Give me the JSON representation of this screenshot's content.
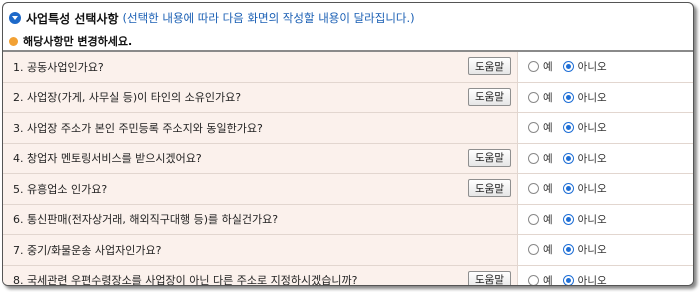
{
  "header": {
    "title": "사업특성 선택사항",
    "note": "(선택한 내용에 따라 다음 화면의 작성할 내용이 달라집니다.)"
  },
  "notice": "해당사항만 변경하세요.",
  "labels": {
    "help": "도움말",
    "yes": "예",
    "no": "아니오"
  },
  "questions": [
    {
      "text": "1. 공동사업인가요?",
      "has_help": true,
      "selected": "no"
    },
    {
      "text": "2. 사업장(가게, 사무실 등)이 타인의 소유인가요?",
      "has_help": true,
      "selected": "no"
    },
    {
      "text": "3. 사업장 주소가 본인 주민등록 주소지와 동일한가요?",
      "has_help": false,
      "selected": "no"
    },
    {
      "text": "4. 창업자 멘토링서비스를 받으시겠어요?",
      "has_help": true,
      "selected": "no"
    },
    {
      "text": "5. 유흥업소 인가요?",
      "has_help": true,
      "selected": "no"
    },
    {
      "text": "6. 통신판매(전자상거래, 해외직구대행 등)를 하실건가요?",
      "has_help": false,
      "selected": "no"
    },
    {
      "text": "7. 중기/화물운송 사업자인가요?",
      "has_help": false,
      "selected": "no"
    },
    {
      "text": "8. 국세관련 우편수령장소를 사업장이 아닌 다른 주소로 지정하시겠습니까?",
      "has_help": true,
      "selected": "no"
    }
  ],
  "colors": {
    "accent": "#1f6fd6",
    "row_bg": "#fbf1ec",
    "notice_dot": "#f2a134"
  }
}
